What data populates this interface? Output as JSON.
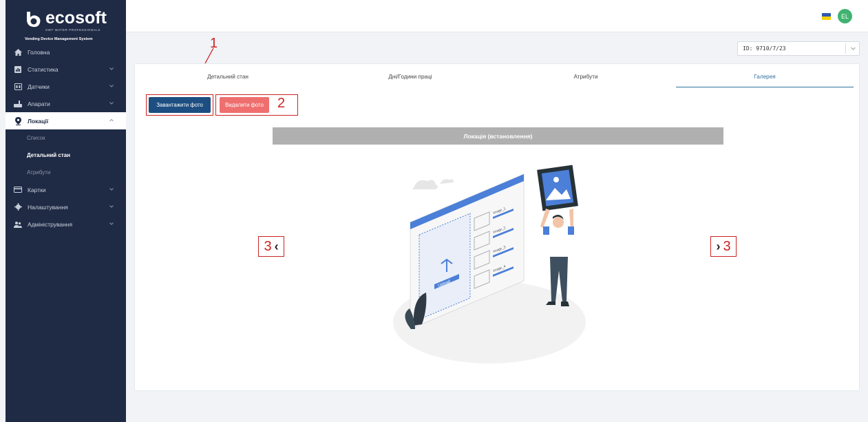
{
  "brand": {
    "name": "ecosoft",
    "tagline": "SWT WATER PROFESSIONALS",
    "system": "Vending Device Management System"
  },
  "sidebar": {
    "items": [
      {
        "label": "Головна",
        "icon": "home-icon"
      },
      {
        "label": "Статистика",
        "icon": "stats-icon"
      },
      {
        "label": "Датчики",
        "icon": "sensor-icon"
      },
      {
        "label": "Апарати",
        "icon": "machine-icon"
      },
      {
        "label": "Локації",
        "icon": "location-pin-icon"
      },
      {
        "label": "Картки",
        "icon": "card-icon"
      },
      {
        "label": "Налаштування",
        "icon": "gear-icon"
      },
      {
        "label": "Адміністрування",
        "icon": "users-icon"
      }
    ],
    "sub_items": [
      "Список",
      "Детальний стан",
      "Атрибути"
    ]
  },
  "header": {
    "avatar_initials": "EL",
    "flag_colors": [
      "#2e5aaa",
      "#f5d20a"
    ]
  },
  "id_select": {
    "value": "ID: 9710/7/23"
  },
  "tabs": [
    {
      "label": "Детальний стан"
    },
    {
      "label": "Дні/Години праці"
    },
    {
      "label": "Атрибути"
    },
    {
      "label": "Галерея"
    }
  ],
  "buttons": {
    "upload_label": "Завантажити фото",
    "delete_label": "Видалити фото"
  },
  "gallery": {
    "header": "Локація (встановлення)",
    "image_labels": [
      "image_1",
      "image_2",
      "image_3",
      "image_4"
    ],
    "upload_label": "Upload"
  },
  "annotations": {
    "one": "1",
    "two": "2",
    "three_left": "3",
    "three_right": "3"
  },
  "colors": {
    "sidebar_bg": "#1f2b45",
    "primary": "#1d4e82",
    "danger": "#ef6f6f",
    "annotation": "#cc2222",
    "avatar": "#3fb36f"
  }
}
